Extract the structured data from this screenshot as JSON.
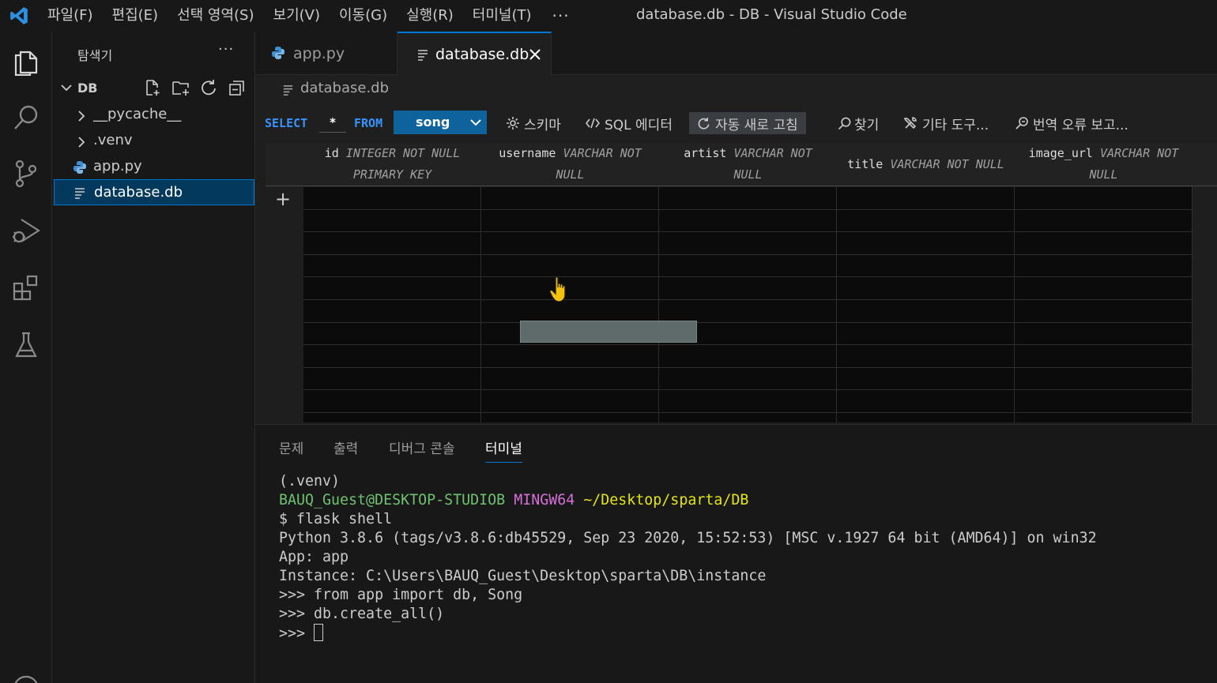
{
  "titlebar": {
    "menus": [
      "파일(F)",
      "편집(E)",
      "선택 영역(S)",
      "보기(V)",
      "이동(G)",
      "실행(R)",
      "터미널(T)"
    ],
    "more": "···",
    "window_title": "database.db - DB - Visual Studio Code"
  },
  "activity_bar": {
    "icons": [
      "explorer-icon",
      "search-icon",
      "source-control-icon",
      "run-debug-icon",
      "extensions-icon",
      "testing-icon"
    ]
  },
  "sidebar": {
    "title": "탐색기",
    "more": "···",
    "folder_label": "DB",
    "items": [
      {
        "label": "__pycache__",
        "type": "folder"
      },
      {
        "label": ".venv",
        "type": "folder"
      },
      {
        "label": "app.py",
        "type": "python"
      },
      {
        "label": "database.db",
        "type": "file",
        "selected": true
      }
    ]
  },
  "tabs": [
    {
      "label": "app.py",
      "active": false
    },
    {
      "label": "database.db",
      "active": true
    }
  ],
  "breadcrumb": "database.db",
  "db_toolbar": {
    "select_kw": "SELECT",
    "select_cols": "*",
    "from_kw": "FROM",
    "table": "song",
    "schema": "스키마",
    "sql_editor": "SQL 에디터",
    "auto_refresh": "자동 새로 고침",
    "find": "찾기",
    "other_tools": "기타 도구...",
    "report": "번역 오류 보고..."
  },
  "grid": {
    "columns": [
      {
        "name": "id",
        "type_l1": "INTEGER NOT NULL",
        "type_l2": "PRIMARY KEY"
      },
      {
        "name": "username",
        "type_l1": "VARCHAR NOT",
        "type_l2": "NULL"
      },
      {
        "name": "artist",
        "type_l1": "VARCHAR NOT",
        "type_l2": "NULL"
      },
      {
        "name": "title",
        "type_l1": "VARCHAR NOT NULL",
        "type_l2": ""
      },
      {
        "name": "image_url",
        "type_l1": "VARCHAR NOT",
        "type_l2": "NULL"
      }
    ],
    "add_row": "+"
  },
  "panel": {
    "tabs": [
      "문제",
      "출력",
      "디버그 콘솔",
      "터미널"
    ],
    "active_tab": "터미널",
    "terminal": {
      "line1": "(.venv)",
      "user_host": "BAUQ_Guest@DESKTOP-STUDIOB",
      "shell": "MINGW64",
      "path": "~/Desktop/sparta/DB",
      "line3": "$ flask shell",
      "line4": "Python 3.8.6 (tags/v3.8.6:db45529, Sep 23 2020, 15:52:53) [MSC v.1927 64 bit (AMD64)] on win32",
      "line5": "App: app",
      "line6": "Instance: C:\\Users\\BAUQ_Guest\\Desktop\\sparta\\DB\\instance",
      "line7": ">>> from app import db, Song",
      "line8": ">>> db.create_all()",
      "line9": ">>> "
    }
  },
  "colors": {
    "accent": "#0078d4",
    "terminal_green": "#23d18b",
    "terminal_magenta": "#d670d6",
    "terminal_yellow": "#e5e510",
    "keyword_blue": "#3794ff"
  }
}
